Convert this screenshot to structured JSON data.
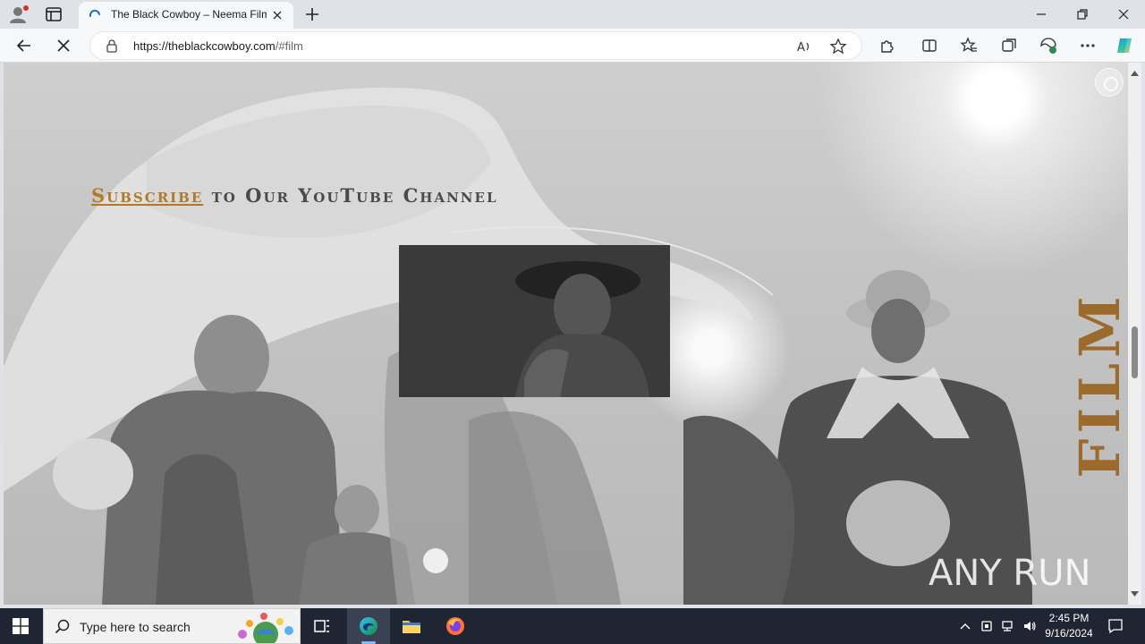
{
  "browser": {
    "tab_title": "The Black Cowboy – Neema Film",
    "url_host": "https://theblackcowboy.com",
    "url_path": "/#film"
  },
  "page": {
    "subscribe_link": "Subscribe",
    "subscribe_rest": " to Our YouTube Channel",
    "side_heading": "FILM",
    "watermark": "ANY RUN"
  },
  "taskbar": {
    "search_placeholder": "Type here to search",
    "time": "2:45 PM",
    "date": "9/16/2024"
  },
  "colors": {
    "accent_gold": "#b07a2a",
    "film_brown": "#9b6a2c",
    "taskbar_bg": "#1f2532"
  }
}
